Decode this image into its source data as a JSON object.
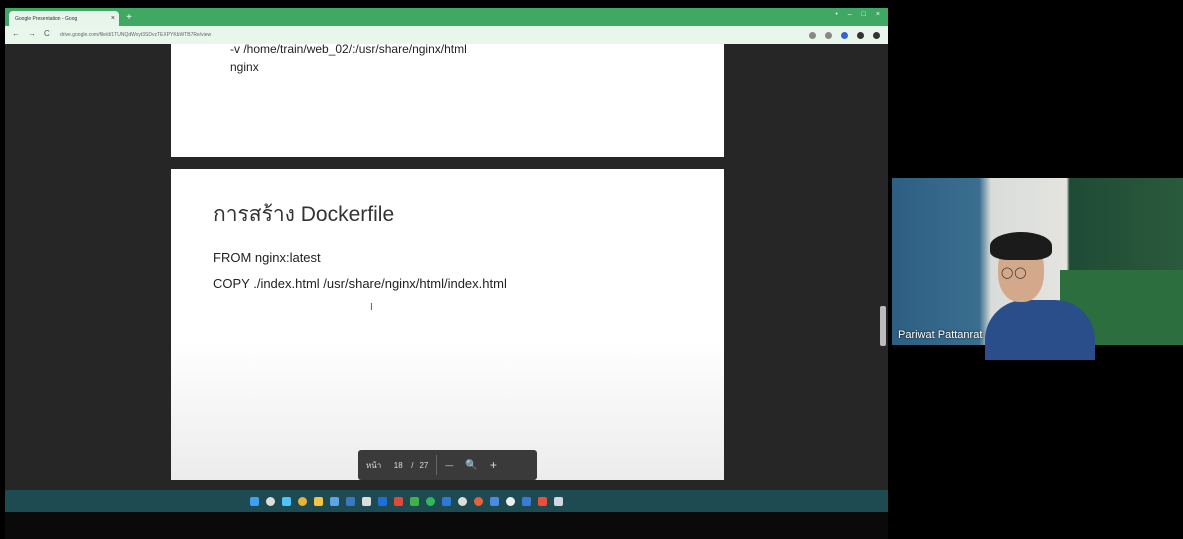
{
  "browser": {
    "tab_title": "Google Presentation - Goog",
    "close_glyph": "×",
    "new_tab_glyph": "+",
    "url": "drive.google.com/file/d/1TUNQdWxyt3SDvzTEXPYKbWTB7Re/view",
    "nav_back": "←",
    "nav_forward": "→",
    "nav_reload": "C",
    "window_controls": [
      "•",
      "–",
      "□",
      "×"
    ]
  },
  "slides": {
    "slide1_text": "-v /home/train/web_02/:/usr/share/nginx/html\nnginx",
    "slide2_title": "การสร้าง Dockerfile",
    "slide2_line1": "FROM nginx:latest",
    "slide2_line2": "COPY ./index.html /usr/share/nginx/html/index.html",
    "cursor_glyph": "I"
  },
  "pager": {
    "page_label": "หน้า",
    "current_page": "18",
    "separator": "/",
    "total_pages": "27",
    "zoom_out": "—",
    "zoom_icon": "🔍",
    "zoom_in": "+"
  },
  "video": {
    "participant_name": "Pariwat Pattanrat",
    "glasses_glyph": "◯◯"
  },
  "colors": {
    "chrome_green": "#3fa863",
    "taskbar": "#1e4b52"
  },
  "taskbar_icons": [
    "windows-icon",
    "search-icon",
    "app-icon",
    "chrome-icon",
    "files-icon",
    "app-icon",
    "app-icon",
    "app-icon",
    "app-icon",
    "app-icon",
    "app-icon",
    "app-icon",
    "app-icon",
    "app-icon",
    "app-icon",
    "app-icon",
    "app-icon",
    "app-icon",
    "app-icon",
    "app-icon"
  ]
}
